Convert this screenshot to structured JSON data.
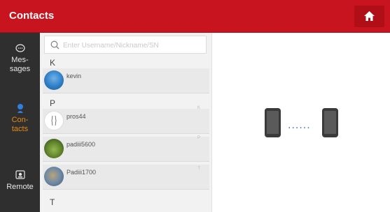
{
  "header": {
    "title": "Contacts",
    "home_icon": "home-icon"
  },
  "sidebar": {
    "items": [
      {
        "label_line1": "Mes-",
        "label_line2": "sages",
        "icon": "chat-bubble-icon",
        "active": false
      },
      {
        "label_line1": "Con-",
        "label_line2": "tacts",
        "icon": "person-icon",
        "active": true
      },
      {
        "label_line1": "Remote",
        "label_line2": "",
        "icon": "remote-screen-icon",
        "active": false
      }
    ]
  },
  "search": {
    "placeholder": "Enter Username/Nickname/SN",
    "icon": "search-icon"
  },
  "groups": [
    {
      "letter": "K",
      "contacts": [
        {
          "name": "kevin"
        }
      ]
    },
    {
      "letter": "P",
      "contacts": [
        {
          "name": "pros44"
        },
        {
          "name": "padiii5600"
        },
        {
          "name": "Padiii1700"
        }
      ]
    },
    {
      "letter": "T",
      "contacts": []
    }
  ],
  "index_letters": [
    "K",
    "P",
    "T"
  ],
  "connection": {
    "left_device": "phone-icon",
    "right_device": "phone-icon",
    "link": "......"
  },
  "colors": {
    "header": "#c8141e",
    "sidebar": "#2f2f2f",
    "active": "#e58a17",
    "link": "#3a76c8"
  }
}
